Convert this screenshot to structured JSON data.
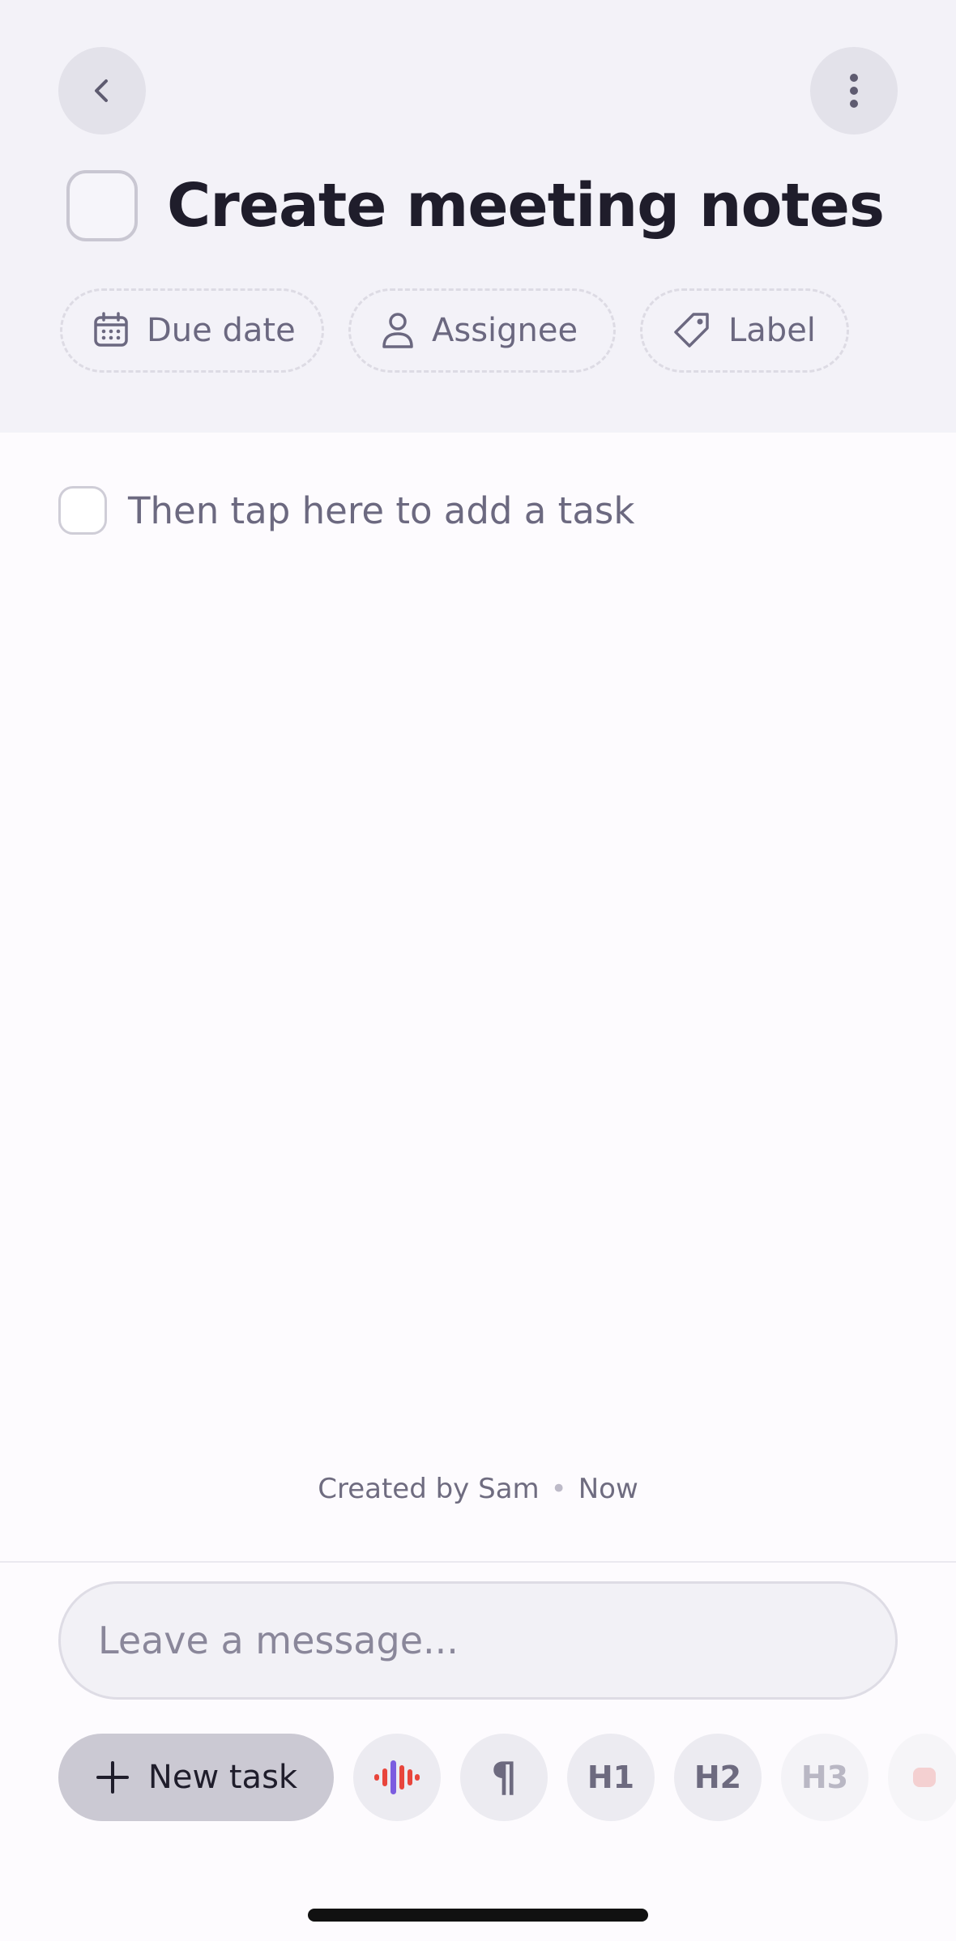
{
  "header": {
    "title": "Create meeting notes",
    "chips": [
      {
        "label": "Due date",
        "icon": "calendar-icon"
      },
      {
        "label": "Assignee",
        "icon": "person-icon"
      },
      {
        "label": "Label",
        "icon": "tag-icon"
      }
    ]
  },
  "body": {
    "task_placeholder": "Then tap here to add a task"
  },
  "footer": {
    "created_by": "Created by Sam",
    "separator": "•",
    "time": "Now",
    "message_placeholder": "Leave a message...",
    "new_task_label": "New task",
    "tools": [
      "¶",
      "H1",
      "H2",
      "H3"
    ]
  },
  "colors": {
    "header_bg": "#f3f2f8",
    "page_bg": "#fdfbfe",
    "accent_red": "#e8453c",
    "accent_purple": "#7b5ce0"
  }
}
